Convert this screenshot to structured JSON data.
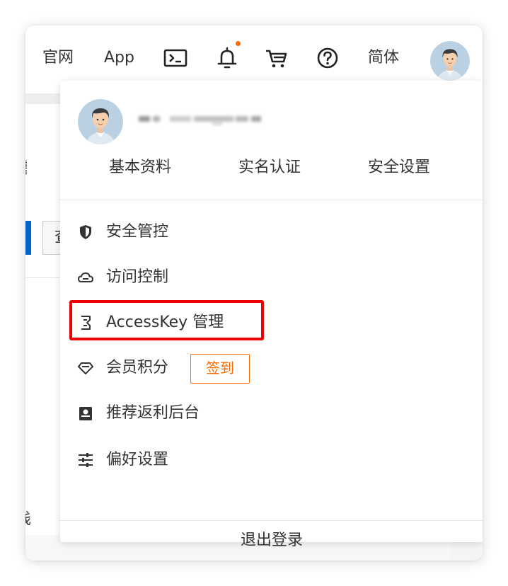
{
  "topbar": {
    "official_site": "官网",
    "app": "App",
    "language": "简体",
    "icons": [
      "terminal-icon",
      "bell-icon",
      "cart-icon",
      "help-icon"
    ]
  },
  "background": {
    "char_1": "量",
    "char_2": "查",
    "char_3": "栈"
  },
  "profile": {
    "links": [
      "基本资料",
      "实名认证",
      "安全设置"
    ]
  },
  "menu": [
    {
      "icon": "shield-icon",
      "label": "安全管控"
    },
    {
      "icon": "cloud-icon",
      "label": "访问控制"
    },
    {
      "icon": "key-icon",
      "label": "AccessKey 管理"
    },
    {
      "icon": "diamond-icon",
      "label": "会员积分"
    },
    {
      "icon": "rebate-icon",
      "label": "推荐返利后台"
    },
    {
      "icon": "sliders-icon",
      "label": "偏好设置"
    }
  ],
  "checkin_label": "签到",
  "logout_label": "退出登录",
  "colors": {
    "accent": "#ff6a00",
    "highlight": "#ee0000",
    "primary_blue": "#0064c8"
  }
}
